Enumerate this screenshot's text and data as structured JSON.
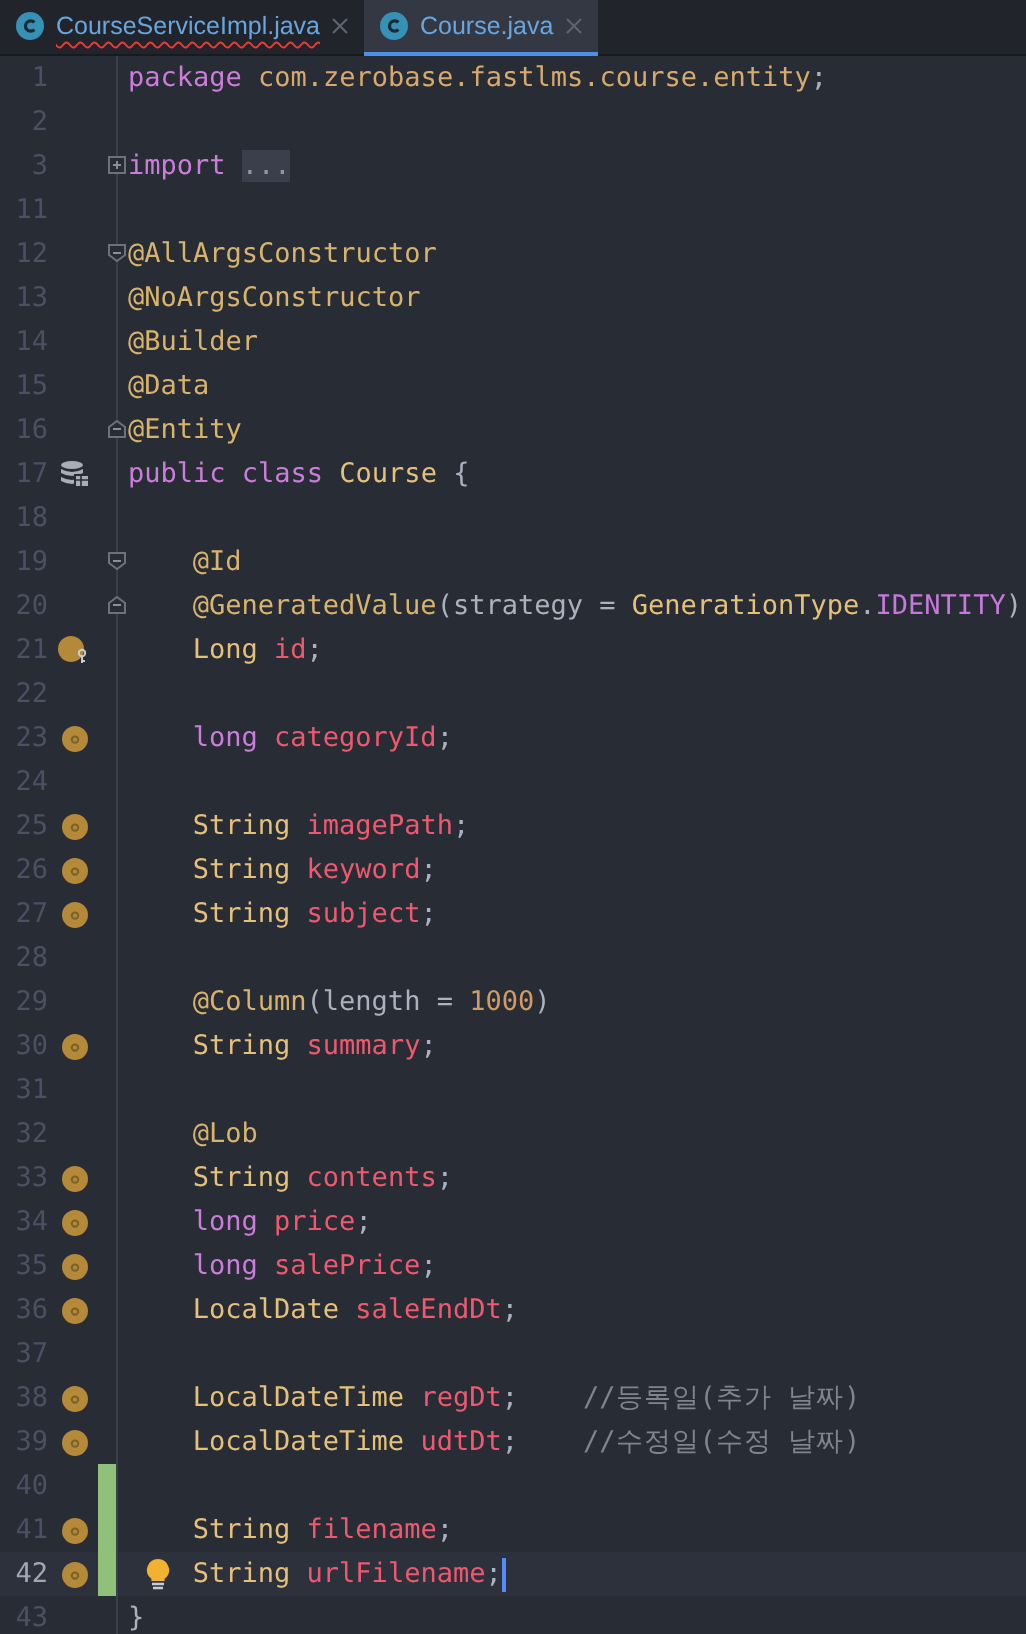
{
  "tabs": [
    {
      "label": "CourseServiceImpl.java",
      "selected": false,
      "error": true
    },
    {
      "label": "Course.java",
      "selected": true,
      "error": false
    }
  ],
  "lines": [
    {
      "number": "1",
      "changed": false,
      "current": false,
      "indented": false,
      "tokens": [
        {
          "kind": "keyword",
          "text": "package"
        },
        {
          "kind": "package",
          "text": " com.zerobase.fastlms.course.entity"
        },
        {
          "kind": "plain",
          "text": ";"
        }
      ]
    },
    {
      "number": "2",
      "changed": false,
      "current": false
    },
    {
      "number": "3",
      "changed": false,
      "current": false,
      "indented": false,
      "fold_marker": {
        "kind": "collapsed"
      },
      "tokens": [
        {
          "kind": "keyword",
          "text": "import "
        },
        {
          "kind": "folded",
          "text": "..."
        }
      ]
    },
    {
      "number": "11",
      "changed": false,
      "current": false
    },
    {
      "number": "12",
      "changed": false,
      "current": false,
      "indented": false,
      "fold_marker": {
        "kind": "start"
      },
      "tokens": [
        {
          "kind": "annotation",
          "text": "@AllArgsConstructor"
        }
      ]
    },
    {
      "number": "13",
      "changed": false,
      "current": false,
      "indented": false,
      "tokens": [
        {
          "kind": "annotation",
          "text": "@NoArgsConstructor"
        }
      ]
    },
    {
      "number": "14",
      "changed": false,
      "current": false,
      "indented": false,
      "tokens": [
        {
          "kind": "annotation",
          "text": "@Builder"
        }
      ]
    },
    {
      "number": "15",
      "changed": false,
      "current": false,
      "indented": false,
      "tokens": [
        {
          "kind": "annotation",
          "text": "@Data"
        }
      ]
    },
    {
      "number": "16",
      "changed": false,
      "current": false,
      "indented": false,
      "fold_marker": {
        "kind": "end"
      },
      "tokens": [
        {
          "kind": "annotation",
          "text": "@Entity"
        }
      ]
    },
    {
      "number": "17",
      "changed": false,
      "current": false,
      "indented": false,
      "gutter_icon": {
        "kind": "entity"
      },
      "tokens": [
        {
          "kind": "keyword",
          "text": "public class"
        },
        {
          "kind": "type",
          "text": " Course"
        },
        {
          "kind": "plain",
          "text": " {"
        }
      ]
    },
    {
      "number": "18",
      "changed": false,
      "current": false
    },
    {
      "number": "19",
      "changed": false,
      "current": false,
      "indented": true,
      "fold_marker": {
        "kind": "start"
      },
      "tokens": [
        {
          "kind": "annotation",
          "text": "@Id"
        }
      ]
    },
    {
      "number": "20",
      "changed": false,
      "current": false,
      "indented": true,
      "fold_marker": {
        "kind": "end"
      },
      "tokens": [
        {
          "kind": "annotation",
          "text": "@GeneratedValue"
        },
        {
          "kind": "plain",
          "text": "(strategy = "
        },
        {
          "kind": "type",
          "text": "GenerationType"
        },
        {
          "kind": "plain",
          "text": "."
        },
        {
          "kind": "constant",
          "text": "IDENTITY"
        },
        {
          "kind": "plain",
          "text": ")"
        }
      ]
    },
    {
      "number": "21",
      "changed": false,
      "current": false,
      "indented": true,
      "gutter_icon": {
        "kind": "field-key"
      },
      "tokens": [
        {
          "kind": "type",
          "text": "Long"
        },
        {
          "kind": "field",
          "text": " id"
        },
        {
          "kind": "plain",
          "text": ";"
        }
      ]
    },
    {
      "number": "22",
      "changed": false,
      "current": false
    },
    {
      "number": "23",
      "changed": false,
      "current": false,
      "indented": true,
      "gutter_icon": {
        "kind": "field"
      },
      "tokens": [
        {
          "kind": "keyword",
          "text": "long"
        },
        {
          "kind": "field",
          "text": " categoryId"
        },
        {
          "kind": "plain",
          "text": ";"
        }
      ]
    },
    {
      "number": "24",
      "changed": false,
      "current": false
    },
    {
      "number": "25",
      "changed": false,
      "current": false,
      "indented": true,
      "gutter_icon": {
        "kind": "field"
      },
      "tokens": [
        {
          "kind": "type",
          "text": "String"
        },
        {
          "kind": "field",
          "text": " imagePath"
        },
        {
          "kind": "plain",
          "text": ";"
        }
      ]
    },
    {
      "number": "26",
      "changed": false,
      "current": false,
      "indented": true,
      "gutter_icon": {
        "kind": "field"
      },
      "tokens": [
        {
          "kind": "type",
          "text": "String"
        },
        {
          "kind": "field",
          "text": " keyword"
        },
        {
          "kind": "plain",
          "text": ";"
        }
      ]
    },
    {
      "number": "27",
      "changed": false,
      "current": false,
      "indented": true,
      "gutter_icon": {
        "kind": "field"
      },
      "tokens": [
        {
          "kind": "type",
          "text": "String"
        },
        {
          "kind": "field",
          "text": " subject"
        },
        {
          "kind": "plain",
          "text": ";"
        }
      ]
    },
    {
      "number": "28",
      "changed": false,
      "current": false
    },
    {
      "number": "29",
      "changed": false,
      "current": false,
      "indented": true,
      "tokens": [
        {
          "kind": "annotation",
          "text": "@Column"
        },
        {
          "kind": "plain",
          "text": "(length = "
        },
        {
          "kind": "number",
          "text": "1000"
        },
        {
          "kind": "plain",
          "text": ")"
        }
      ]
    },
    {
      "number": "30",
      "changed": false,
      "current": false,
      "indented": true,
      "gutter_icon": {
        "kind": "field"
      },
      "tokens": [
        {
          "kind": "type",
          "text": "String"
        },
        {
          "kind": "field",
          "text": " summary"
        },
        {
          "kind": "plain",
          "text": ";"
        }
      ]
    },
    {
      "number": "31",
      "changed": false,
      "current": false
    },
    {
      "number": "32",
      "changed": false,
      "current": false,
      "indented": true,
      "tokens": [
        {
          "kind": "annotation",
          "text": "@Lob"
        }
      ]
    },
    {
      "number": "33",
      "changed": false,
      "current": false,
      "indented": true,
      "gutter_icon": {
        "kind": "field"
      },
      "tokens": [
        {
          "kind": "type",
          "text": "String"
        },
        {
          "kind": "field",
          "text": " contents"
        },
        {
          "kind": "plain",
          "text": ";"
        }
      ]
    },
    {
      "number": "34",
      "changed": false,
      "current": false,
      "indented": true,
      "gutter_icon": {
        "kind": "field"
      },
      "tokens": [
        {
          "kind": "keyword",
          "text": "long"
        },
        {
          "kind": "field",
          "text": " price"
        },
        {
          "kind": "plain",
          "text": ";"
        }
      ]
    },
    {
      "number": "35",
      "changed": false,
      "current": false,
      "indented": true,
      "gutter_icon": {
        "kind": "field"
      },
      "tokens": [
        {
          "kind": "keyword",
          "text": "long"
        },
        {
          "kind": "field",
          "text": " salePrice"
        },
        {
          "kind": "plain",
          "text": ";"
        }
      ]
    },
    {
      "number": "36",
      "changed": false,
      "current": false,
      "indented": true,
      "gutter_icon": {
        "kind": "field"
      },
      "tokens": [
        {
          "kind": "type",
          "text": "LocalDate"
        },
        {
          "kind": "field",
          "text": " saleEndDt"
        },
        {
          "kind": "plain",
          "text": ";"
        }
      ]
    },
    {
      "number": "37",
      "changed": false,
      "current": false
    },
    {
      "number": "38",
      "changed": false,
      "current": false,
      "indented": true,
      "gutter_icon": {
        "kind": "field"
      },
      "tokens": [
        {
          "kind": "type",
          "text": "LocalDateTime"
        },
        {
          "kind": "field",
          "text": " regDt"
        },
        {
          "kind": "plain",
          "text": ";"
        },
        {
          "kind": "comment",
          "text": "    //등록일(추가 날짜)"
        }
      ]
    },
    {
      "number": "39",
      "changed": false,
      "current": false,
      "indented": true,
      "gutter_icon": {
        "kind": "field"
      },
      "tokens": [
        {
          "kind": "type",
          "text": "LocalDateTime"
        },
        {
          "kind": "field",
          "text": " udtDt"
        },
        {
          "kind": "plain",
          "text": ";"
        },
        {
          "kind": "comment",
          "text": "    //수정일(수정 날짜)"
        }
      ]
    },
    {
      "number": "40",
      "changed": true,
      "current": false
    },
    {
      "number": "41",
      "changed": true,
      "current": false,
      "indented": true,
      "gutter_icon": {
        "kind": "field"
      },
      "tokens": [
        {
          "kind": "type",
          "text": "String"
        },
        {
          "kind": "field",
          "text": " filename"
        },
        {
          "kind": "plain",
          "text": ";"
        }
      ]
    },
    {
      "number": "42",
      "changed": true,
      "current": true,
      "indented": true,
      "gutter_icon": {
        "kind": "field"
      },
      "tokens": [
        {
          "kind": "type",
          "text": "String"
        },
        {
          "kind": "field",
          "text": " urlFilename"
        },
        {
          "kind": "plain",
          "text": ";"
        }
      ]
    },
    {
      "number": "43",
      "changed": false,
      "current": false,
      "indented": false,
      "tokens": [
        {
          "kind": "plain",
          "text": "}"
        }
      ]
    }
  ]
}
